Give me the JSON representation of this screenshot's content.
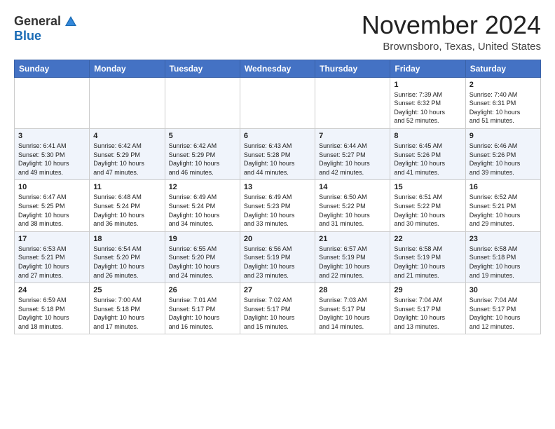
{
  "logo": {
    "general": "General",
    "blue": "Blue"
  },
  "header": {
    "month": "November 2024",
    "location": "Brownsboro, Texas, United States"
  },
  "days_of_week": [
    "Sunday",
    "Monday",
    "Tuesday",
    "Wednesday",
    "Thursday",
    "Friday",
    "Saturday"
  ],
  "weeks": [
    [
      {
        "day": "",
        "info": ""
      },
      {
        "day": "",
        "info": ""
      },
      {
        "day": "",
        "info": ""
      },
      {
        "day": "",
        "info": ""
      },
      {
        "day": "",
        "info": ""
      },
      {
        "day": "1",
        "info": "Sunrise: 7:39 AM\nSunset: 6:32 PM\nDaylight: 10 hours\nand 52 minutes."
      },
      {
        "day": "2",
        "info": "Sunrise: 7:40 AM\nSunset: 6:31 PM\nDaylight: 10 hours\nand 51 minutes."
      }
    ],
    [
      {
        "day": "3",
        "info": "Sunrise: 6:41 AM\nSunset: 5:30 PM\nDaylight: 10 hours\nand 49 minutes."
      },
      {
        "day": "4",
        "info": "Sunrise: 6:42 AM\nSunset: 5:29 PM\nDaylight: 10 hours\nand 47 minutes."
      },
      {
        "day": "5",
        "info": "Sunrise: 6:42 AM\nSunset: 5:29 PM\nDaylight: 10 hours\nand 46 minutes."
      },
      {
        "day": "6",
        "info": "Sunrise: 6:43 AM\nSunset: 5:28 PM\nDaylight: 10 hours\nand 44 minutes."
      },
      {
        "day": "7",
        "info": "Sunrise: 6:44 AM\nSunset: 5:27 PM\nDaylight: 10 hours\nand 42 minutes."
      },
      {
        "day": "8",
        "info": "Sunrise: 6:45 AM\nSunset: 5:26 PM\nDaylight: 10 hours\nand 41 minutes."
      },
      {
        "day": "9",
        "info": "Sunrise: 6:46 AM\nSunset: 5:26 PM\nDaylight: 10 hours\nand 39 minutes."
      }
    ],
    [
      {
        "day": "10",
        "info": "Sunrise: 6:47 AM\nSunset: 5:25 PM\nDaylight: 10 hours\nand 38 minutes."
      },
      {
        "day": "11",
        "info": "Sunrise: 6:48 AM\nSunset: 5:24 PM\nDaylight: 10 hours\nand 36 minutes."
      },
      {
        "day": "12",
        "info": "Sunrise: 6:49 AM\nSunset: 5:24 PM\nDaylight: 10 hours\nand 34 minutes."
      },
      {
        "day": "13",
        "info": "Sunrise: 6:49 AM\nSunset: 5:23 PM\nDaylight: 10 hours\nand 33 minutes."
      },
      {
        "day": "14",
        "info": "Sunrise: 6:50 AM\nSunset: 5:22 PM\nDaylight: 10 hours\nand 31 minutes."
      },
      {
        "day": "15",
        "info": "Sunrise: 6:51 AM\nSunset: 5:22 PM\nDaylight: 10 hours\nand 30 minutes."
      },
      {
        "day": "16",
        "info": "Sunrise: 6:52 AM\nSunset: 5:21 PM\nDaylight: 10 hours\nand 29 minutes."
      }
    ],
    [
      {
        "day": "17",
        "info": "Sunrise: 6:53 AM\nSunset: 5:21 PM\nDaylight: 10 hours\nand 27 minutes."
      },
      {
        "day": "18",
        "info": "Sunrise: 6:54 AM\nSunset: 5:20 PM\nDaylight: 10 hours\nand 26 minutes."
      },
      {
        "day": "19",
        "info": "Sunrise: 6:55 AM\nSunset: 5:20 PM\nDaylight: 10 hours\nand 24 minutes."
      },
      {
        "day": "20",
        "info": "Sunrise: 6:56 AM\nSunset: 5:19 PM\nDaylight: 10 hours\nand 23 minutes."
      },
      {
        "day": "21",
        "info": "Sunrise: 6:57 AM\nSunset: 5:19 PM\nDaylight: 10 hours\nand 22 minutes."
      },
      {
        "day": "22",
        "info": "Sunrise: 6:58 AM\nSunset: 5:19 PM\nDaylight: 10 hours\nand 21 minutes."
      },
      {
        "day": "23",
        "info": "Sunrise: 6:58 AM\nSunset: 5:18 PM\nDaylight: 10 hours\nand 19 minutes."
      }
    ],
    [
      {
        "day": "24",
        "info": "Sunrise: 6:59 AM\nSunset: 5:18 PM\nDaylight: 10 hours\nand 18 minutes."
      },
      {
        "day": "25",
        "info": "Sunrise: 7:00 AM\nSunset: 5:18 PM\nDaylight: 10 hours\nand 17 minutes."
      },
      {
        "day": "26",
        "info": "Sunrise: 7:01 AM\nSunset: 5:17 PM\nDaylight: 10 hours\nand 16 minutes."
      },
      {
        "day": "27",
        "info": "Sunrise: 7:02 AM\nSunset: 5:17 PM\nDaylight: 10 hours\nand 15 minutes."
      },
      {
        "day": "28",
        "info": "Sunrise: 7:03 AM\nSunset: 5:17 PM\nDaylight: 10 hours\nand 14 minutes."
      },
      {
        "day": "29",
        "info": "Sunrise: 7:04 AM\nSunset: 5:17 PM\nDaylight: 10 hours\nand 13 minutes."
      },
      {
        "day": "30",
        "info": "Sunrise: 7:04 AM\nSunset: 5:17 PM\nDaylight: 10 hours\nand 12 minutes."
      }
    ]
  ]
}
